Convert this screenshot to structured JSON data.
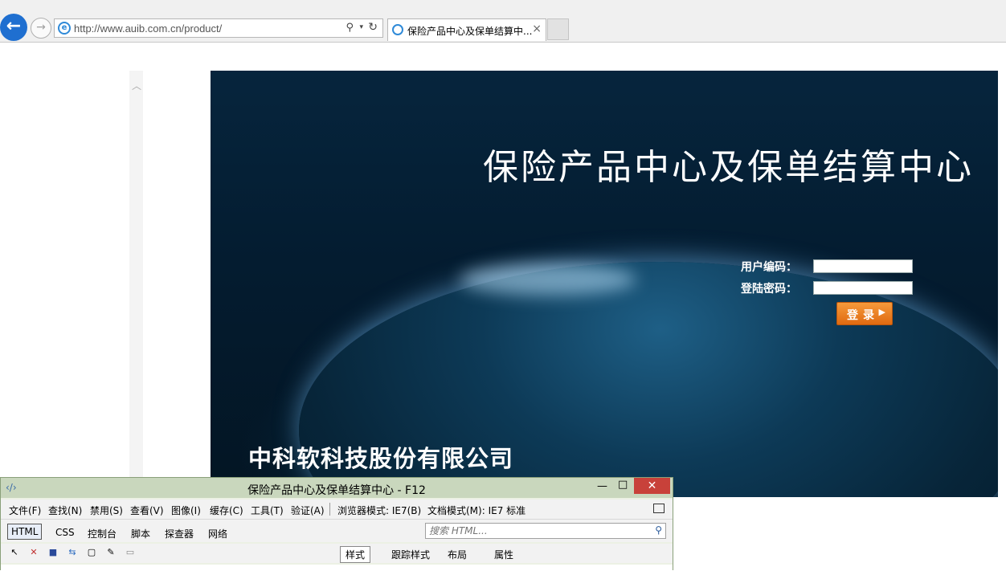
{
  "browser": {
    "url": "http://www.auib.com.cn/product/",
    "tab_title": "保险产品中心及保单结算中...",
    "tab_close": "×",
    "back_glyph": "←",
    "forward_glyph": "→",
    "search_glyph": "⚲",
    "dropdown_glyph": "▾",
    "refresh_glyph": "↻"
  },
  "hero": {
    "title": "保险产品中心及保单结算中心",
    "user_label": "用户编码：",
    "password_label": "登陆密码：",
    "user_value": "",
    "password_value": "",
    "login_label": "登录",
    "login_arrow": "▶",
    "company": "中科软科技股份有限公司"
  },
  "devtools": {
    "title": "保险产品中心及保单结算中心 - F12",
    "min_glyph": "—",
    "max_glyph": "□",
    "close_glyph": "✕",
    "menu": [
      "文件(F)",
      "查找(N)",
      "禁用(S)",
      "查看(V)",
      "图像(I)",
      "缓存(C)",
      "工具(T)",
      "验证(A)"
    ],
    "browser_mode": "浏览器模式: IE7(B)",
    "doc_mode": "文档模式(M): IE7 标准",
    "tabs": [
      "HTML",
      "CSS",
      "控制台",
      "脚本",
      "探查器",
      "网络"
    ],
    "search_placeholder": "搜索 HTML...",
    "right_tabs": [
      "样式",
      "跟踪样式",
      "布局",
      "属性"
    ]
  }
}
